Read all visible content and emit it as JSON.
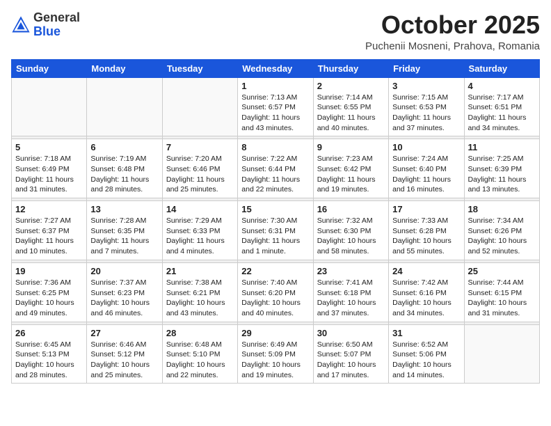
{
  "header": {
    "logo_general": "General",
    "logo_blue": "Blue",
    "month_title": "October 2025",
    "location": "Puchenii Mosneni, Prahova, Romania"
  },
  "weekdays": [
    "Sunday",
    "Monday",
    "Tuesday",
    "Wednesday",
    "Thursday",
    "Friday",
    "Saturday"
  ],
  "weeks": [
    [
      {
        "day": "",
        "info": ""
      },
      {
        "day": "",
        "info": ""
      },
      {
        "day": "",
        "info": ""
      },
      {
        "day": "1",
        "info": "Sunrise: 7:13 AM\nSunset: 6:57 PM\nDaylight: 11 hours\nand 43 minutes."
      },
      {
        "day": "2",
        "info": "Sunrise: 7:14 AM\nSunset: 6:55 PM\nDaylight: 11 hours\nand 40 minutes."
      },
      {
        "day": "3",
        "info": "Sunrise: 7:15 AM\nSunset: 6:53 PM\nDaylight: 11 hours\nand 37 minutes."
      },
      {
        "day": "4",
        "info": "Sunrise: 7:17 AM\nSunset: 6:51 PM\nDaylight: 11 hours\nand 34 minutes."
      }
    ],
    [
      {
        "day": "5",
        "info": "Sunrise: 7:18 AM\nSunset: 6:49 PM\nDaylight: 11 hours\nand 31 minutes."
      },
      {
        "day": "6",
        "info": "Sunrise: 7:19 AM\nSunset: 6:48 PM\nDaylight: 11 hours\nand 28 minutes."
      },
      {
        "day": "7",
        "info": "Sunrise: 7:20 AM\nSunset: 6:46 PM\nDaylight: 11 hours\nand 25 minutes."
      },
      {
        "day": "8",
        "info": "Sunrise: 7:22 AM\nSunset: 6:44 PM\nDaylight: 11 hours\nand 22 minutes."
      },
      {
        "day": "9",
        "info": "Sunrise: 7:23 AM\nSunset: 6:42 PM\nDaylight: 11 hours\nand 19 minutes."
      },
      {
        "day": "10",
        "info": "Sunrise: 7:24 AM\nSunset: 6:40 PM\nDaylight: 11 hours\nand 16 minutes."
      },
      {
        "day": "11",
        "info": "Sunrise: 7:25 AM\nSunset: 6:39 PM\nDaylight: 11 hours\nand 13 minutes."
      }
    ],
    [
      {
        "day": "12",
        "info": "Sunrise: 7:27 AM\nSunset: 6:37 PM\nDaylight: 11 hours\nand 10 minutes."
      },
      {
        "day": "13",
        "info": "Sunrise: 7:28 AM\nSunset: 6:35 PM\nDaylight: 11 hours\nand 7 minutes."
      },
      {
        "day": "14",
        "info": "Sunrise: 7:29 AM\nSunset: 6:33 PM\nDaylight: 11 hours\nand 4 minutes."
      },
      {
        "day": "15",
        "info": "Sunrise: 7:30 AM\nSunset: 6:31 PM\nDaylight: 11 hours\nand 1 minute."
      },
      {
        "day": "16",
        "info": "Sunrise: 7:32 AM\nSunset: 6:30 PM\nDaylight: 10 hours\nand 58 minutes."
      },
      {
        "day": "17",
        "info": "Sunrise: 7:33 AM\nSunset: 6:28 PM\nDaylight: 10 hours\nand 55 minutes."
      },
      {
        "day": "18",
        "info": "Sunrise: 7:34 AM\nSunset: 6:26 PM\nDaylight: 10 hours\nand 52 minutes."
      }
    ],
    [
      {
        "day": "19",
        "info": "Sunrise: 7:36 AM\nSunset: 6:25 PM\nDaylight: 10 hours\nand 49 minutes."
      },
      {
        "day": "20",
        "info": "Sunrise: 7:37 AM\nSunset: 6:23 PM\nDaylight: 10 hours\nand 46 minutes."
      },
      {
        "day": "21",
        "info": "Sunrise: 7:38 AM\nSunset: 6:21 PM\nDaylight: 10 hours\nand 43 minutes."
      },
      {
        "day": "22",
        "info": "Sunrise: 7:40 AM\nSunset: 6:20 PM\nDaylight: 10 hours\nand 40 minutes."
      },
      {
        "day": "23",
        "info": "Sunrise: 7:41 AM\nSunset: 6:18 PM\nDaylight: 10 hours\nand 37 minutes."
      },
      {
        "day": "24",
        "info": "Sunrise: 7:42 AM\nSunset: 6:16 PM\nDaylight: 10 hours\nand 34 minutes."
      },
      {
        "day": "25",
        "info": "Sunrise: 7:44 AM\nSunset: 6:15 PM\nDaylight: 10 hours\nand 31 minutes."
      }
    ],
    [
      {
        "day": "26",
        "info": "Sunrise: 6:45 AM\nSunset: 5:13 PM\nDaylight: 10 hours\nand 28 minutes."
      },
      {
        "day": "27",
        "info": "Sunrise: 6:46 AM\nSunset: 5:12 PM\nDaylight: 10 hours\nand 25 minutes."
      },
      {
        "day": "28",
        "info": "Sunrise: 6:48 AM\nSunset: 5:10 PM\nDaylight: 10 hours\nand 22 minutes."
      },
      {
        "day": "29",
        "info": "Sunrise: 6:49 AM\nSunset: 5:09 PM\nDaylight: 10 hours\nand 19 minutes."
      },
      {
        "day": "30",
        "info": "Sunrise: 6:50 AM\nSunset: 5:07 PM\nDaylight: 10 hours\nand 17 minutes."
      },
      {
        "day": "31",
        "info": "Sunrise: 6:52 AM\nSunset: 5:06 PM\nDaylight: 10 hours\nand 14 minutes."
      },
      {
        "day": "",
        "info": ""
      }
    ]
  ]
}
